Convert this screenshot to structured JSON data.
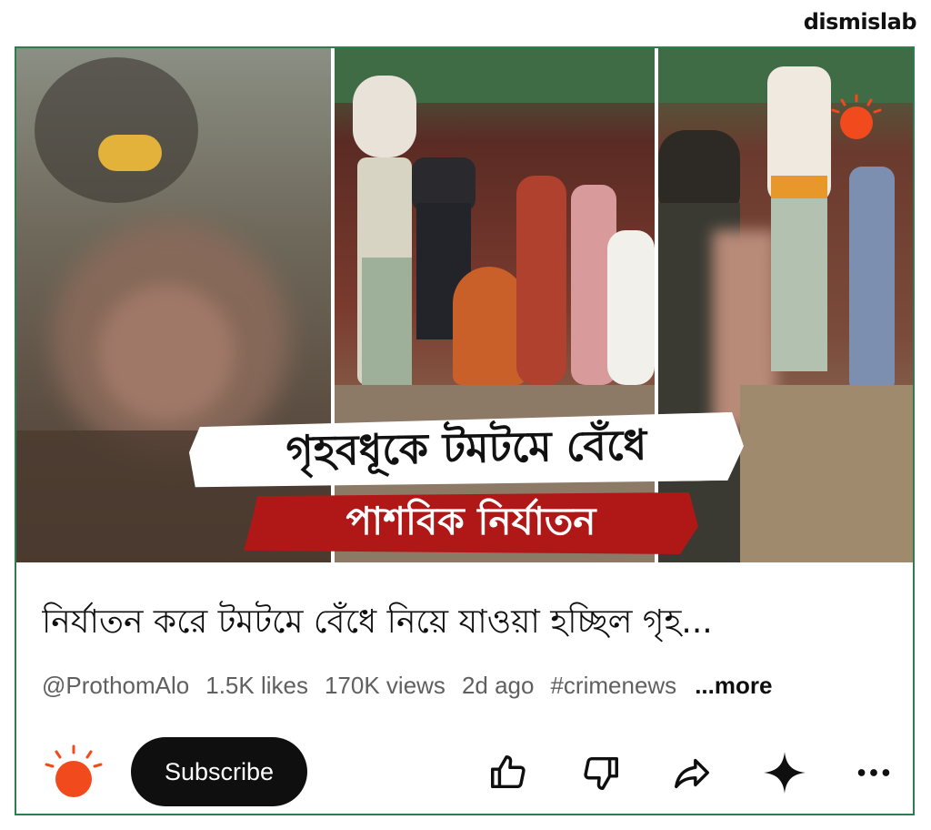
{
  "brand": {
    "name": "dismislab"
  },
  "thumbnail": {
    "headline_line1": "গৃহবধূকে টমটমে বেঁধে",
    "headline_line2": "পাশবিক নির্যাতন"
  },
  "video": {
    "title": "নির্যাতন করে টমটমে বেঁধে নিয়ে যাওয়া হচ্ছিল গৃহ...",
    "channel": "@ProthomAlo",
    "likes": "1.5K likes",
    "views": "170K views",
    "age": "2d ago",
    "hashtag": "#crimenews",
    "more": "...more"
  },
  "actions": {
    "subscribe_label": "Subscribe",
    "icons": [
      "like-icon",
      "dislike-icon",
      "share-icon",
      "remix-icon",
      "more-menu-icon"
    ]
  },
  "colors": {
    "frame": "#2e7d4f",
    "sun": "#f04a1d",
    "banner_red": "#b01818"
  }
}
